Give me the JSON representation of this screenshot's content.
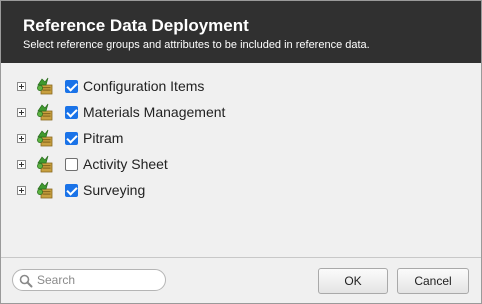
{
  "dialog": {
    "title": "Reference Data Deployment",
    "subtitle": "Select reference groups and attributes to be included in reference data."
  },
  "tree": {
    "items": [
      {
        "label": "Configuration Items",
        "checked": true,
        "icon": "reference-group-icon",
        "expander": "expand-plus-icon"
      },
      {
        "label": "Materials Management",
        "checked": true,
        "icon": "reference-group-icon",
        "expander": "expand-plus-icon"
      },
      {
        "label": "Pitram",
        "checked": true,
        "icon": "reference-group-icon",
        "expander": "expand-plus-icon"
      },
      {
        "label": "Activity Sheet",
        "checked": false,
        "icon": "reference-group-icon",
        "expander": "expand-plus-icon"
      },
      {
        "label": "Surveying",
        "checked": true,
        "icon": "reference-group-icon",
        "expander": "expand-plus-icon"
      }
    ]
  },
  "footer": {
    "search": {
      "placeholder": "Search",
      "value": "",
      "icon": "search-icon"
    },
    "ok_label": "OK",
    "cancel_label": "Cancel"
  },
  "colors": {
    "header_bg": "#303030",
    "body_bg": "#f0f0f0",
    "checkbox_accent": "#1a73e8"
  }
}
